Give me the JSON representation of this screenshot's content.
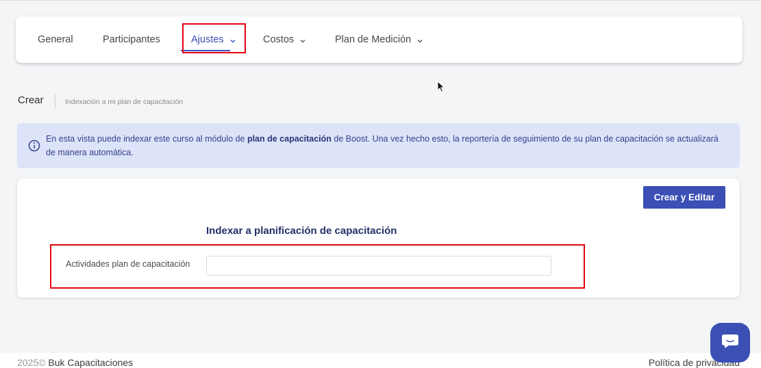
{
  "nav": {
    "tabs": [
      {
        "label": "General"
      },
      {
        "label": "Participantes"
      },
      {
        "label": "Ajustes"
      },
      {
        "label": "Costos"
      },
      {
        "label": "Plan de Medición"
      }
    ]
  },
  "breadcrumb": {
    "title": "Crear",
    "subtitle": "Indexación a mi plan de capacitación"
  },
  "info": {
    "text_before": "En esta vista puede indexar este curso al módulo de ",
    "text_bold": "plan de capacitación",
    "text_after": " de Boost. Una vez hecho esto, la reportería de seguimiento de su plan de capacitación se actualizará de manera automática."
  },
  "form": {
    "create_button": "Crear y Editar",
    "section_title": "Indexar a planificación de capacitación",
    "field_label": "Actividades plan de capacitación",
    "field_value": ""
  },
  "footer": {
    "year": "2025©",
    "company": "Buk Capacitaciones",
    "privacy": "Política de privacidad"
  },
  "colors": {
    "accent": "#3b4fb4",
    "highlight": "#e3000f",
    "info_bg": "#dde3f8"
  },
  "icons": [
    "chevron-down-icon",
    "info-icon",
    "chat-icon",
    "mouse-cursor-icon"
  ]
}
